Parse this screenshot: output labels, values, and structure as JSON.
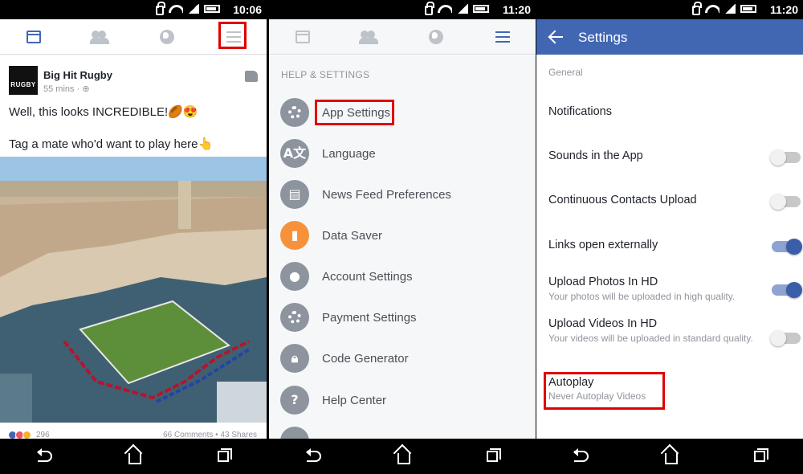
{
  "status_bar": {
    "time_1": "10:06",
    "time_2": "11:20",
    "time_3": "11:20"
  },
  "post": {
    "author": "Big Hit Rugby",
    "avatar_text": "RUGBY",
    "time": "55 mins",
    "line1": "Well, this looks INCREDIBLE!🏉😍",
    "line2": "Tag a mate who'd want to play here👆",
    "reactions_count": "296",
    "comments_shares": "66 Comments • 43 Shares"
  },
  "menu": {
    "section_title": "HELP & SETTINGS",
    "items": [
      {
        "label": "App Settings",
        "icon": "gear-icon"
      },
      {
        "label": "Language",
        "icon": "translate-icon"
      },
      {
        "label": "News Feed Preferences",
        "icon": "news-feed-icon"
      },
      {
        "label": "Data Saver",
        "icon": "bar-chart-icon"
      },
      {
        "label": "Account Settings",
        "icon": "account-gear-icon"
      },
      {
        "label": "Payment Settings",
        "icon": "gear-icon"
      },
      {
        "label": "Code Generator",
        "icon": "lock-icon"
      },
      {
        "label": "Help Center",
        "icon": "question-icon"
      }
    ]
  },
  "settings": {
    "title": "Settings",
    "general_label": "General",
    "rows": [
      {
        "title": "Notifications",
        "subtitle": ""
      },
      {
        "title": "Sounds in the App",
        "subtitle": "",
        "toggle": "off"
      },
      {
        "title": "Continuous Contacts Upload",
        "subtitle": "",
        "toggle": "off"
      },
      {
        "title": "Links open externally",
        "subtitle": "",
        "toggle": "on"
      },
      {
        "title": "Upload Photos In HD",
        "subtitle": "Your photos will be uploaded in high quality.",
        "toggle": "on"
      },
      {
        "title": "Upload Videos In HD",
        "subtitle": "Your videos will be uploaded in standard quality.",
        "toggle": "off"
      },
      {
        "title": "Autoplay",
        "subtitle": "Never Autoplay Videos"
      }
    ]
  },
  "colors": {
    "brand": "#4267b2",
    "highlight": "#e00000",
    "data_saver": "#f7923b"
  }
}
